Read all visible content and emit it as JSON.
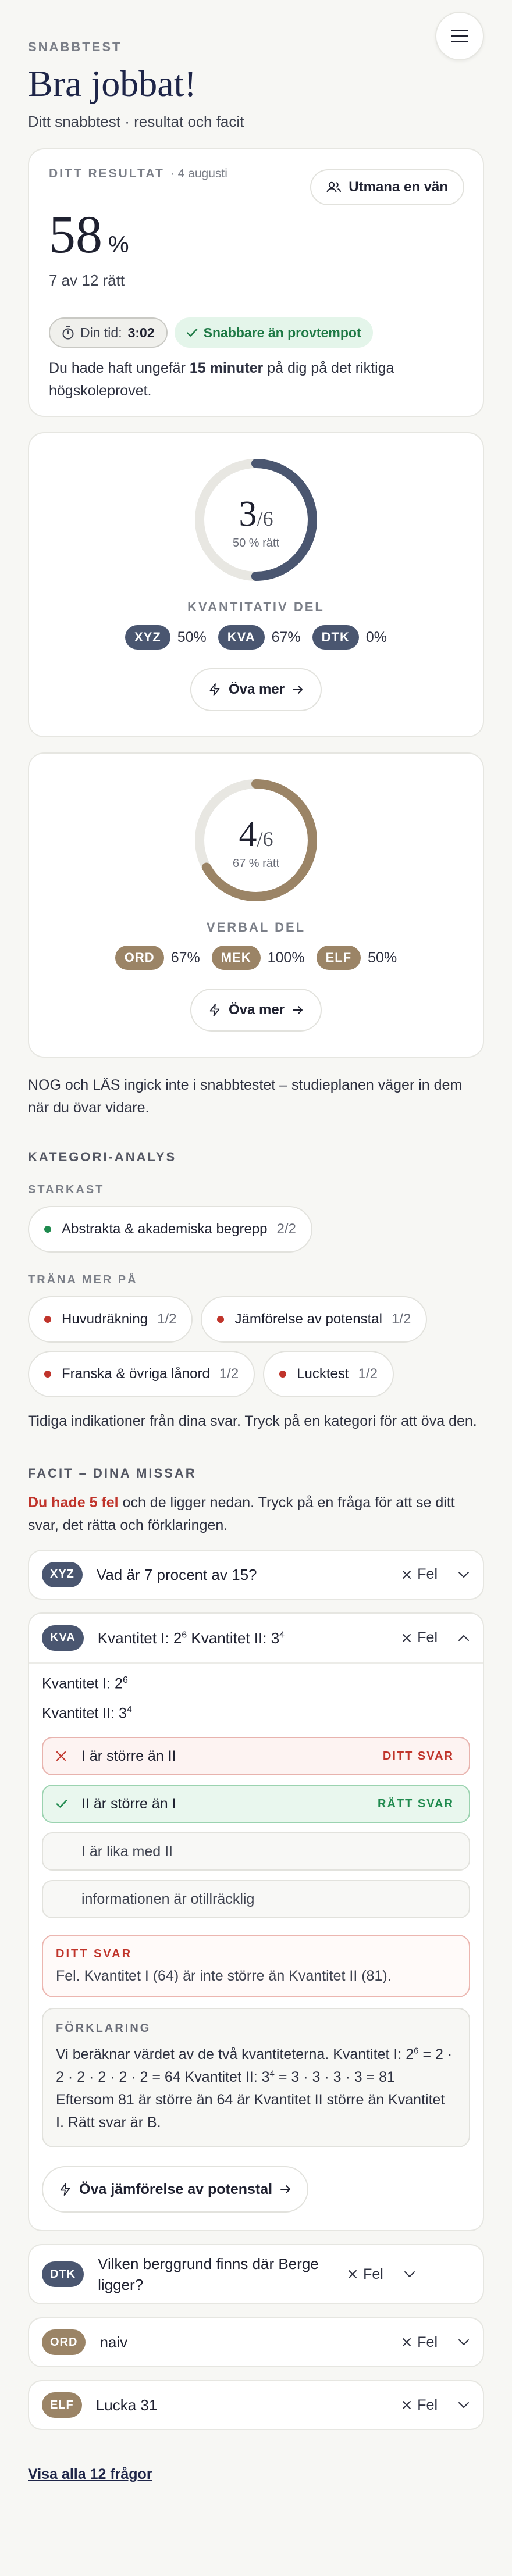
{
  "header": {
    "eyebrow": "SNABBTEST",
    "title": "Bra jobbat!",
    "subtitle": "Ditt snabbtest · resultat och facit",
    "menu_icon": "hamburger-menu-icon"
  },
  "result": {
    "label": "DITT RESULTAT",
    "date": "· 4 augusti",
    "challenge_label": "Utmana en vän",
    "score_value": "58",
    "score_unit": "%",
    "correct_text": "7 av 12 rätt",
    "time_label": "Din tid:",
    "time_value": "3:02",
    "faster_label": "Snabbare än provtempot",
    "note_before": "Du hade haft ungefär ",
    "note_bold": "15 minuter",
    "note_after": " på dig på det riktiga högskoleprovet."
  },
  "sections": [
    {
      "fraction_num": "3",
      "fraction_den": "/6",
      "percent_text": "50 % rätt",
      "progress": 0.5,
      "color": "#4a5670",
      "label": "KVANTITATIV DEL",
      "chips": [
        {
          "code": "XYZ",
          "value": "50%"
        },
        {
          "code": "KVA",
          "value": "67%"
        },
        {
          "code": "DTK",
          "value": "0%"
        }
      ],
      "practice_label": "Öva mer"
    },
    {
      "fraction_num": "4",
      "fraction_den": "/6",
      "percent_text": "67 % rätt",
      "progress": 0.67,
      "color": "#9b8466",
      "label": "VERBAL DEL",
      "chips": [
        {
          "code": "ORD",
          "value": "67%"
        },
        {
          "code": "MEK",
          "value": "100%"
        },
        {
          "code": "ELF",
          "value": "50%"
        }
      ],
      "practice_label": "Öva mer"
    }
  ],
  "excluded_note": "NOG och LÄS ingick inte i snabbtestet – studieplanen väger in dem när du övar vidare.",
  "categories": {
    "title": "KATEGORI-ANALYS",
    "strong_label": "STARKAST",
    "strong": [
      {
        "name": "Abstrakta & akademiska begrepp",
        "count": "2/2"
      }
    ],
    "train_label": "TRÄNA MER PÅ",
    "train": [
      {
        "name": "Huvudräkning",
        "count": "1/2"
      },
      {
        "name": "Jämförelse av potenstal",
        "count": "1/2"
      },
      {
        "name": "Franska & övriga lånord",
        "count": "1/2"
      },
      {
        "name": "Lucktest",
        "count": "1/2"
      }
    ],
    "note": "Tidiga indikationer från dina svar. Tryck på en kategori för att öva den."
  },
  "facit": {
    "title": "FACIT – DINA MISSAR",
    "intro_bold": "Du hade 5 fel",
    "intro_rest": " och de ligger nedan. Tryck på en fråga för att se ditt svar, det rätta och förklaringen.",
    "status_label": "Fel",
    "q1": {
      "code": "XYZ",
      "text": "Vad är 7 procent av 15?"
    },
    "q2": {
      "code": "KVA",
      "head_a": "Kvantitet I: 2",
      "head_a_sup": "6",
      "head_b": " Kvantitet II: 3",
      "head_b_sup": "4",
      "stmt1": "Kvantitet I: 2",
      "stmt1_sup": "6",
      "stmt2": "Kvantitet II: 3",
      "stmt2_sup": "4",
      "options": [
        {
          "text": "I är större än II",
          "state": "wrong",
          "tag": "DITT SVAR"
        },
        {
          "text": "II är större än I",
          "state": "right",
          "tag": "RÄTT SVAR"
        },
        {
          "text": "I är lika med II",
          "state": "none",
          "tag": ""
        },
        {
          "text": "informationen är otillräcklig",
          "state": "none",
          "tag": ""
        }
      ],
      "answer_label": "DITT SVAR",
      "answer_text": "Fel. Kvantitet I (64) är inte större än Kvantitet II (81).",
      "expl_label": "FÖRKLARING",
      "expl_1": "Vi beräknar värdet av de två kvantiteterna. Kvantitet I: ",
      "expl_2": "2",
      "expl_2_sup": "6",
      "expl_3": " = 2 · 2 · 2 · 2 · 2 · 2 = 64 Kvantitet II: ",
      "expl_4": "3",
      "expl_4_sup": "4",
      "expl_5": " = 3 · 3 · 3 · 3 = 81 Eftersom 81 är större än 64 är Kvantitet II större än Kvantitet I. Rätt svar är B.",
      "practice_label": "Öva jämförelse av potenstal"
    },
    "q3": {
      "code": "DTK",
      "text": "Vilken berggrund finns där Berge ligger?"
    },
    "q4": {
      "code": "ORD",
      "text": "naiv"
    },
    "q5": {
      "code": "ELF",
      "text": "Lucka 31"
    },
    "show_all": "Visa alla 12 frågor"
  },
  "colors": {
    "navy": "#1e2548",
    "quant": "#4a5670",
    "verbal": "#9b8466",
    "success": "#1f8a4e",
    "error": "#c0342b",
    "strong_dot": "#1f8a4e",
    "weak_dot": "#c0342b"
  }
}
